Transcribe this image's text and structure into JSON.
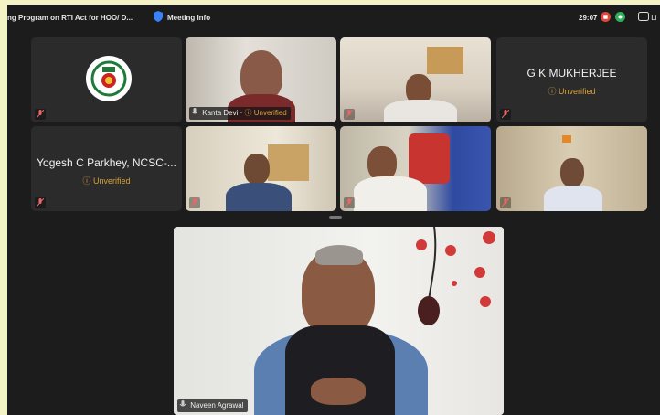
{
  "meeting": {
    "title": "ng Program on RTI Act for  HOO/ D...",
    "info_label": "Meeting Info",
    "timer": "29:07",
    "leave_label": "Li"
  },
  "participants": {
    "logo_tile": {},
    "kanta": {
      "name": "Kanta Devi",
      "status": "ⓘ Unverified"
    },
    "p3": {},
    "gk": {
      "name": "G K MUKHERJEE",
      "status": "ⓘ Unverified"
    },
    "yogesh": {
      "name": "Yogesh C Parkhey, NCSC-...",
      "status": "ⓘ Unverified"
    },
    "p6": {},
    "p7": {},
    "p8": {},
    "naveen": {
      "name": "Naveen Agrawal"
    }
  },
  "colors": {
    "accent": "#3aa79a",
    "unverified": "#d8a23a",
    "record": "#e0473c",
    "chat": "#2fb15b"
  }
}
